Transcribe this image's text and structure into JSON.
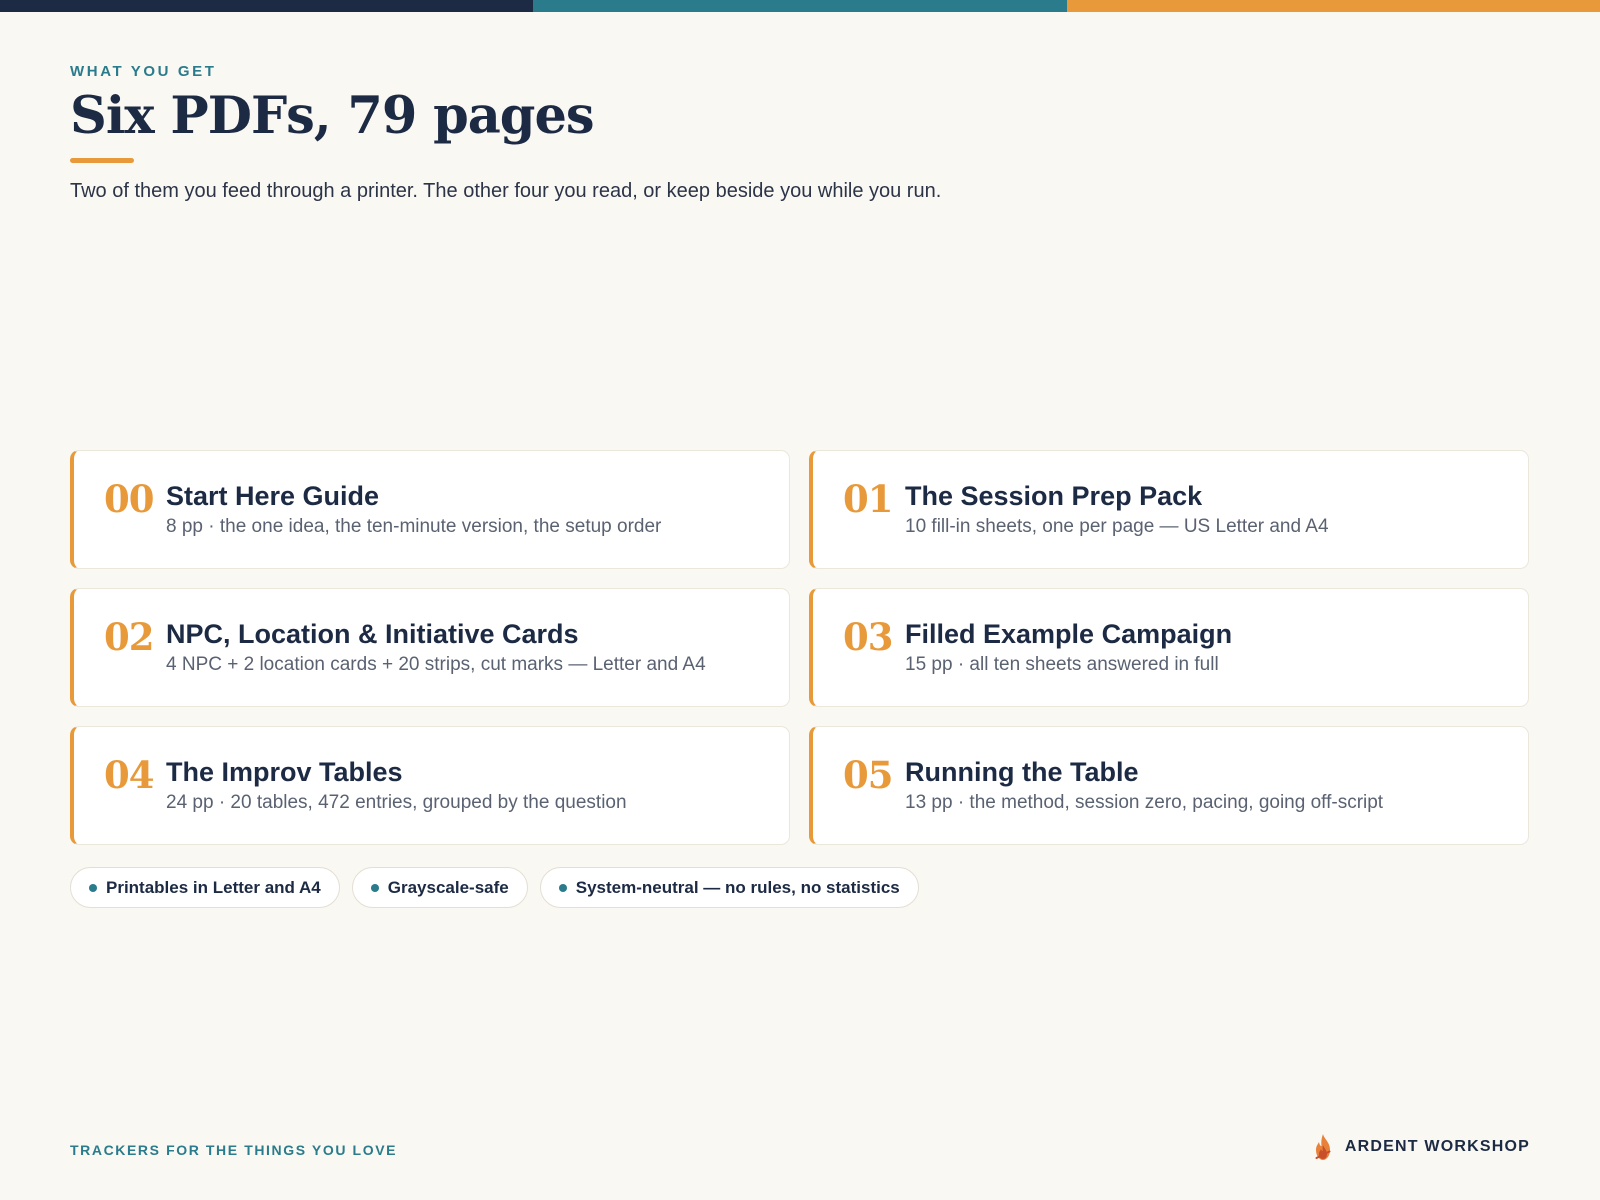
{
  "colors": {
    "navy": "#1c2a44",
    "teal": "#2a7b8c",
    "orange": "#e89a3b",
    "background": "#faf8f2"
  },
  "top_bar": [
    "#1c2a44",
    "#2a7b8c",
    "#e89a3b"
  ],
  "header": {
    "eyebrow": "WHAT YOU GET",
    "title": "Six PDFs, 79 pages",
    "subtitle": "Two of them you feed through a printer. The other four you read, or keep beside you while you run."
  },
  "cards": [
    {
      "number": "00",
      "title": "Start Here Guide",
      "description": "8 pp · the one idea, the ten-minute version, the setup order"
    },
    {
      "number": "01",
      "title": "The Session Prep Pack",
      "description": "10 fill-in sheets, one per page — US Letter and A4"
    },
    {
      "number": "02",
      "title": "NPC, Location & Initiative Cards",
      "description": "4 NPC + 2 location cards + 20 strips, cut marks — Letter and A4"
    },
    {
      "number": "03",
      "title": "Filled Example Campaign",
      "description": "15 pp · all ten sheets answered in full"
    },
    {
      "number": "04",
      "title": "The Improv Tables",
      "description": "24 pp · 20 tables, 472 entries, grouped by the question"
    },
    {
      "number": "05",
      "title": "Running the Table",
      "description": "13 pp · the method, session zero, pacing, going off-script"
    }
  ],
  "pills": [
    "Printables in Letter and A4",
    "Grayscale-safe",
    "System-neutral — no rules, no statistics"
  ],
  "footer": {
    "tagline": "TRACKERS FOR THE THINGS YOU LOVE",
    "brand": "ARDENT WORKSHOP",
    "brand_icon": "flame-logo-icon"
  }
}
